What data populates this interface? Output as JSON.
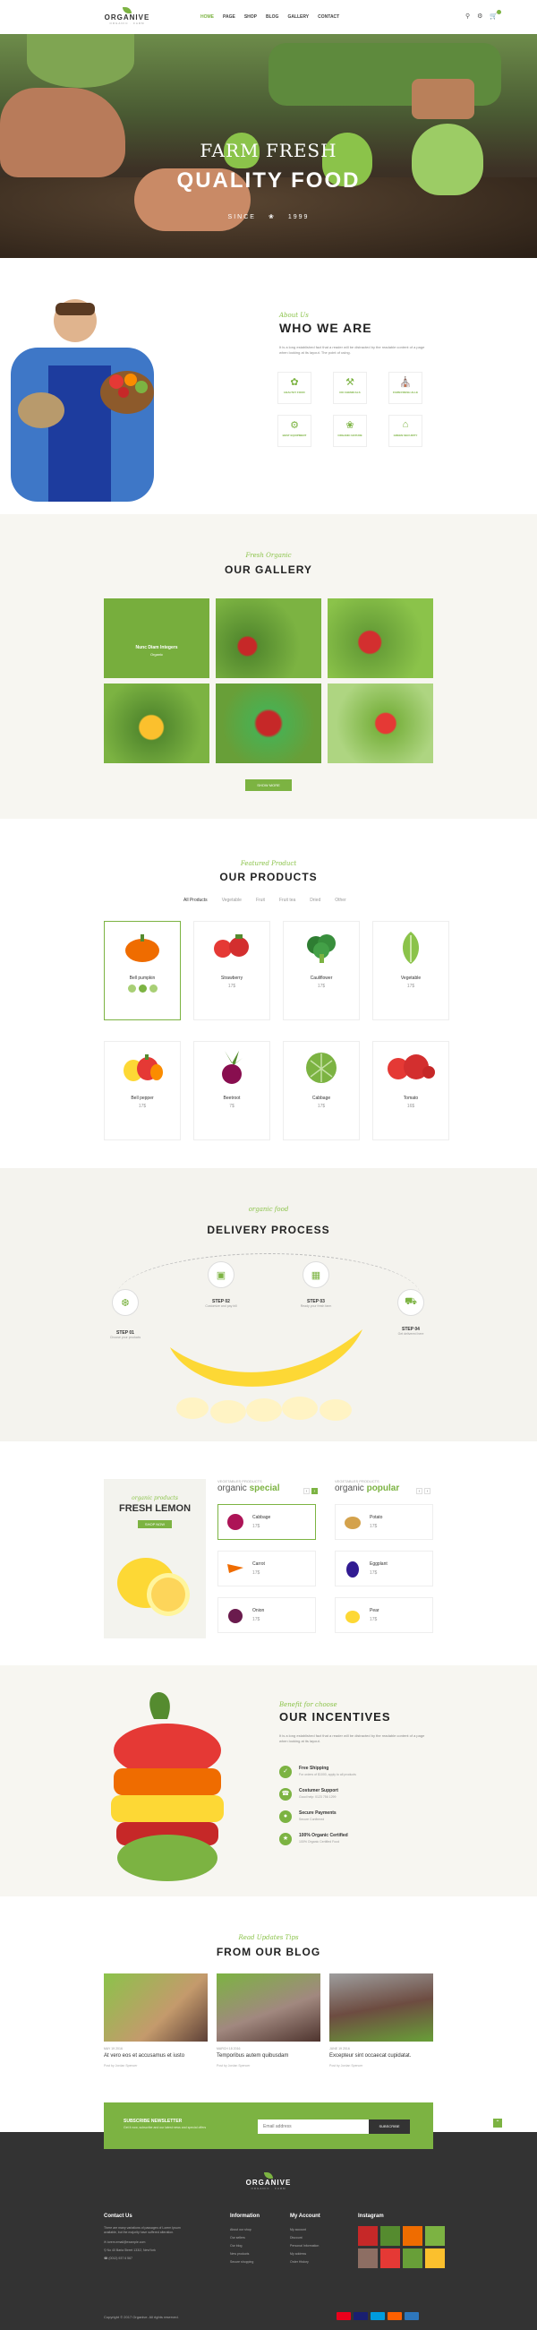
{
  "header": {
    "logo_name": "ORGANIVE",
    "logo_tag": "ORGANIC · FARM",
    "nav": [
      "HOME",
      "PAGE",
      "SHOP",
      "BLOG",
      "GALLERY",
      "CONTACT"
    ]
  },
  "hero": {
    "line1": "FARM FRESH",
    "line2": "QUALITY FOOD",
    "line3_left": "SINCE",
    "line3_right": "1999"
  },
  "who": {
    "subtitle": "About Us",
    "title": "WHO WE ARE",
    "paragraph": "It is a long established fact that a reader will be distracted by the readable content of a page when looking at its layout. The point of using.",
    "features": [
      "HEALTHY FOOD",
      "NO CHEMICALS",
      "FARM FRESH ALLE",
      "BEST EQUIPMENT",
      "ORGANIC NATURE",
      "GREEN SECURITY"
    ]
  },
  "gallery": {
    "subtitle": "Fresh Organic",
    "title": "OUR GALLERY",
    "overlay_title": "Nunc Diam Integers",
    "overlay_sub": "Organic",
    "button": "SHOW MORE"
  },
  "products": {
    "subtitle": "Featured Product",
    "title": "OUR PRODUCTS",
    "tabs": [
      "All Products",
      "Vegetable",
      "Fruit",
      "Fruit tea",
      "Dried",
      "Other"
    ],
    "items": [
      {
        "name": "Bell pumpkin",
        "price": ""
      },
      {
        "name": "Strawberry",
        "price": "17$"
      },
      {
        "name": "Cauliflower",
        "price": "17$"
      },
      {
        "name": "Vegetable",
        "price": "17$"
      },
      {
        "name": "Bell pepper",
        "price": "17$"
      },
      {
        "name": "Beetroot",
        "price": "7$"
      },
      {
        "name": "Cabbage",
        "price": "17$"
      },
      {
        "name": "Tomato",
        "price": "16$"
      }
    ]
  },
  "delivery": {
    "subtitle": "organic food",
    "title": "DELIVERY PROCESS",
    "steps": [
      {
        "label": "STEP 01",
        "sub": "Choose your products"
      },
      {
        "label": "STEP 02",
        "sub": "Customize and pay bill"
      },
      {
        "label": "STEP 03",
        "sub": "Ready your fresh farm"
      },
      {
        "label": "STEP 04",
        "sub": "Get delivered here"
      }
    ]
  },
  "special": {
    "lemon_sub": "organic products",
    "lemon_title": "FRESH LEMON",
    "lemon_btn": "SHOP NOW",
    "col1_sub": "VEGETABLES PRODUCTS",
    "col1_a": "organic",
    "col1_b": "special",
    "col2_sub": "VEGETABLES PRODUCTS",
    "col2_a": "organic",
    "col2_b": "popular",
    "col1_items": [
      {
        "name": "Cabbage",
        "price": "17$"
      },
      {
        "name": "Carrot",
        "price": "17$"
      },
      {
        "name": "Onion",
        "price": "17$"
      }
    ],
    "col2_items": [
      {
        "name": "Potato",
        "price": "17$"
      },
      {
        "name": "Eggplant",
        "price": "17$"
      },
      {
        "name": "Pear",
        "price": "17$"
      }
    ]
  },
  "incentives": {
    "subtitle": "Benefit for choose",
    "title": "OUR INCENTIVES",
    "paragraph": "It is a long established fact that a reader will be distracted by the readable content of a page when looking at its layout.",
    "items": [
      {
        "title": "Free Shipping",
        "sub": "For orders of $1000, apply to all products"
      },
      {
        "title": "Costumer Support",
        "sub": "Good help: 0123 756 1299"
      },
      {
        "title": "Secure Payments",
        "sub": "Secure Confirmed"
      },
      {
        "title": "100% Organic Certified",
        "sub": "100% Organic Certified Food"
      }
    ]
  },
  "blog": {
    "subtitle": "Read Updates Tips",
    "title": "FROM OUR BLOG",
    "posts": [
      {
        "date": "MAY 19 2016",
        "title": "At vero eos et accusamus et iusto",
        "by": "Post by Jordan Spencer"
      },
      {
        "date": "MARCH 18 2016",
        "title": "Temporibus autem quibusdam",
        "by": "Post by Jordan Spencer"
      },
      {
        "date": "JUNE 19 2016",
        "title": "Excepteur sint occaecat cupidatat.",
        "by": "Post by Jordan Spencer"
      }
    ]
  },
  "newsletter": {
    "title": "SUBSCRIBE NEWSLETTER",
    "sub": "Get it now, subscribe and our latest news and special offers",
    "placeholder": "Email address",
    "button": "SUBSCRIBE"
  },
  "footer": {
    "contact_h": "Contact Us",
    "contact_p": "There are many variations of passages of Lorem Ipsum available, but the majority have suffered alteration.",
    "contact_lines": [
      "lorem.email@example.com",
      "No 40 Baria Street 133/2, NewYork",
      "(0012) 937 6 567"
    ],
    "info_h": "Information",
    "info": [
      "About our shop",
      "Our sellers",
      "Our blog",
      "New products",
      "Secure shopping"
    ],
    "account_h": "My Account",
    "account": [
      "My account",
      "Discount",
      "Personal Information",
      "My address",
      "Order History"
    ],
    "insta_h": "Instagram",
    "copyright": "Copyright © 2017 Organive. All rights reserved."
  }
}
